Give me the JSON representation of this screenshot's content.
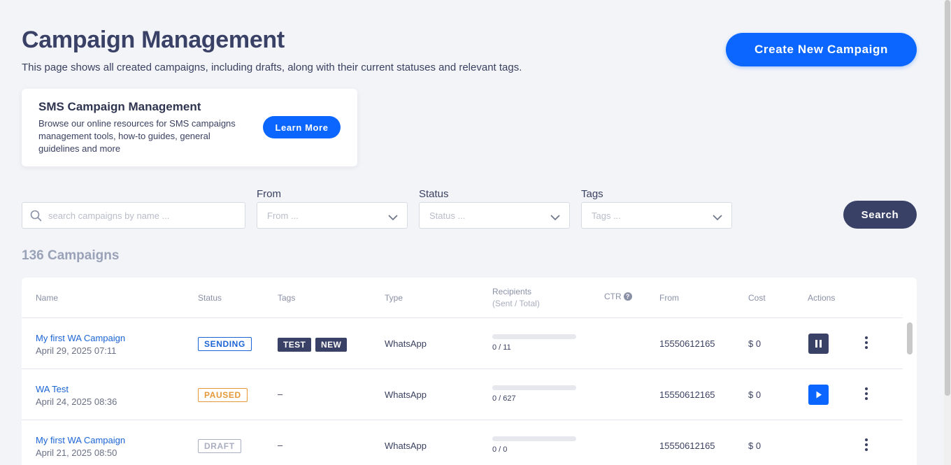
{
  "header": {
    "title": "Campaign Management",
    "subtitle": "This page shows all created campaigns, including drafts, along with their current statuses and relevant tags.",
    "create_button": "Create New Campaign"
  },
  "promo": {
    "title": "SMS Campaign Management",
    "text": "Browse our online resources for SMS campaigns management tools, how-to guides, general guidelines and more",
    "button": "Learn More"
  },
  "filters": {
    "search_placeholder": "search campaigns by name ...",
    "from_label": "From",
    "from_placeholder": "From ...",
    "status_label": "Status",
    "status_placeholder": "Status ...",
    "tags_label": "Tags",
    "tags_placeholder": "Tags ...",
    "search_button": "Search"
  },
  "count_text": "136 Campaigns",
  "colors": {
    "accent": "#0a66ff",
    "navy": "#3a4166",
    "sending": "#1b64d6",
    "paused": "#e6993a",
    "draft": "#a9aec0"
  },
  "table": {
    "columns": {
      "name": "Name",
      "status": "Status",
      "tags": "Tags",
      "type": "Type",
      "recipients": "Recipients",
      "recipients_sub": "(Sent / Total)",
      "ctr": "CTR",
      "from": "From",
      "cost": "Cost",
      "actions": "Actions"
    },
    "rows": [
      {
        "name": "My first WA Campaign",
        "date": "April 29, 2025 07:11",
        "status": "SENDING",
        "tags": [
          "TEST",
          "NEW"
        ],
        "type": "WhatsApp",
        "recipients": "0 / 11",
        "progress": 0,
        "from": "15550612165",
        "cost": "$ 0",
        "action": "pause-icon"
      },
      {
        "name": "WA Test",
        "date": "April 24, 2025 08:36",
        "status": "PAUSED",
        "tags_empty": "–",
        "type": "WhatsApp",
        "recipients": "0 / 627",
        "progress": 0,
        "from": "15550612165",
        "cost": "$ 0",
        "action": "play-icon"
      },
      {
        "name": "My first WA Campaign",
        "date": "April 21, 2025 08:50",
        "status": "DRAFT",
        "tags_empty": "–",
        "type": "WhatsApp",
        "recipients": "0 / 0",
        "progress": 0,
        "from": "15550612165",
        "cost": "$ 0"
      }
    ]
  }
}
